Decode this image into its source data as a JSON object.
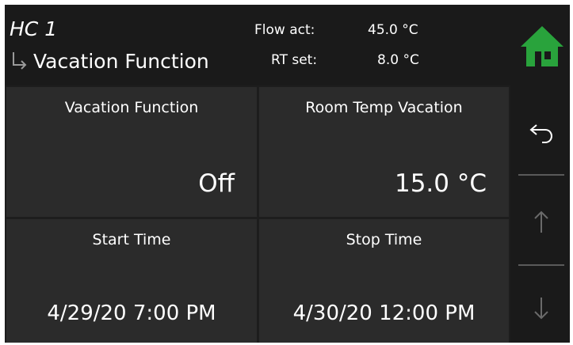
{
  "header": {
    "circuit": "HC 1",
    "title": "Vacation Function",
    "flow_label": "Flow act:",
    "flow_value": "45.0 °C",
    "rt_label": "RT set:",
    "rt_value": "8.0 °C"
  },
  "tiles": {
    "vacation_function": {
      "title": "Vacation Function",
      "value": "Off"
    },
    "room_temp": {
      "title": "Room Temp Vacation",
      "value": "15.0 °C"
    },
    "start_time": {
      "title": "Start Time",
      "value": "4/29/20 7:00 PM"
    },
    "stop_time": {
      "title": "Stop Time",
      "value": "4/30/20 12:00 PM"
    }
  },
  "icons": {
    "home": "home-icon",
    "back": "back-icon",
    "up": "arrow-up-icon",
    "down": "arrow-down-icon",
    "submenu": "submenu-arrow-icon"
  },
  "colors": {
    "background": "#1d1d1d",
    "tile": "#2b2b2b",
    "home_accent": "#29a33c",
    "disabled_arrow": "#6a6a6a"
  }
}
